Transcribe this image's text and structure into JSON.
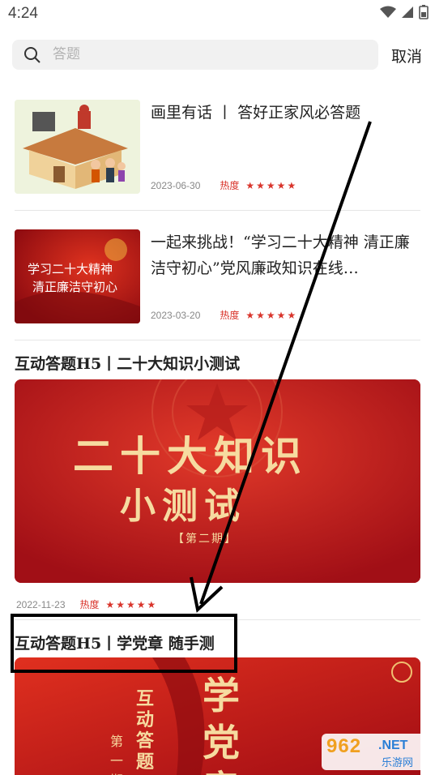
{
  "status": {
    "time": "4:24"
  },
  "search": {
    "placeholder": "答题",
    "cancel_label": "取消"
  },
  "items": [
    {
      "title": "画里有话 丨 答好正家风必答题",
      "date": "2023-06-30",
      "hot_label": "热度",
      "stars": "★★★★★"
    },
    {
      "title": "一起来挑战！“学习二十大精神 清正廉洁守初心”党风廉政知识在线…",
      "date": "2023-03-20",
      "hot_label": "热度",
      "stars": "★★★★★",
      "thumb_text_line1": "学习二十大精神",
      "thumb_text_line2": "清正廉洁守初心"
    }
  ],
  "feature1": {
    "title": "互动答题H5丨二十大知识小测试",
    "banner_line1": "二十大知识",
    "banner_line2": "小测试",
    "banner_line3": "【第二期】",
    "date": "2022-11-23",
    "hot_label": "热度",
    "stars": "★★★★★"
  },
  "feature2": {
    "title": "互动答题H5丨学党章 随手测",
    "banner_vertical": "学党章",
    "banner_side": "互动答题",
    "banner_issue": "第一期"
  },
  "watermark": {
    "num": "962",
    "net": ".NET",
    "sub": "乐游网"
  },
  "colors": {
    "accent_red": "#d9342b",
    "banner_red": "#c8161d"
  }
}
